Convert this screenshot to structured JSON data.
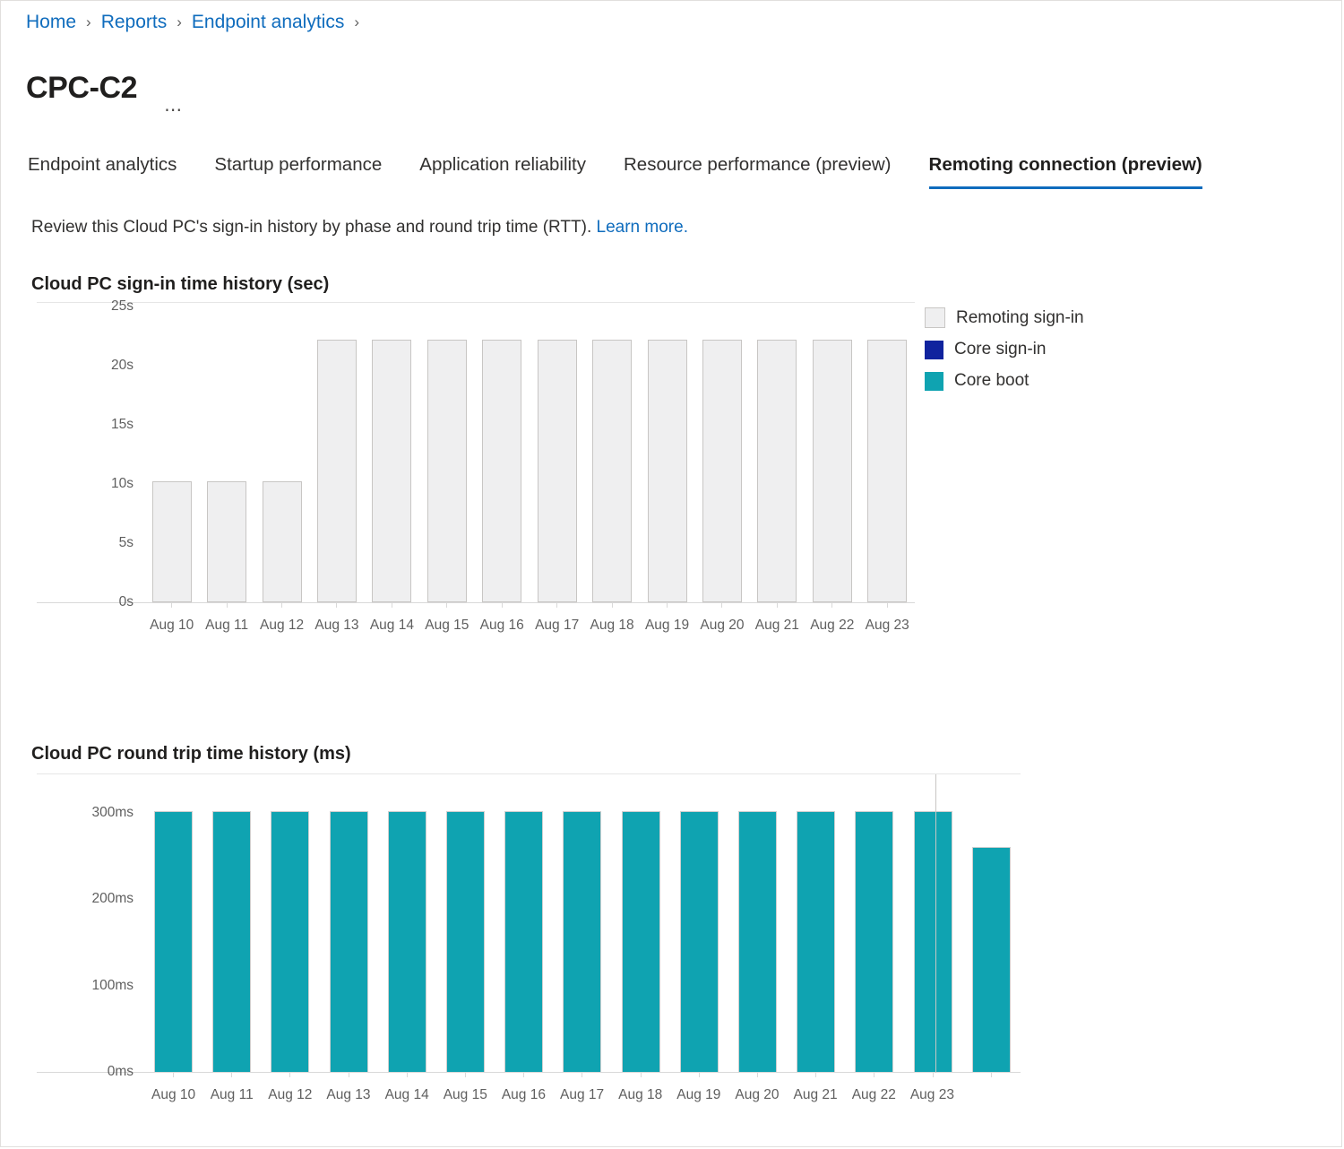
{
  "breadcrumb": {
    "items": [
      {
        "label": "Home"
      },
      {
        "label": "Reports"
      },
      {
        "label": "Endpoint analytics"
      }
    ],
    "separator": "›"
  },
  "header": {
    "title": "CPC-C2",
    "overflow_label": "⋯"
  },
  "tabs": [
    {
      "label": "Endpoint analytics",
      "active": false
    },
    {
      "label": "Startup performance",
      "active": false
    },
    {
      "label": "Application reliability",
      "active": false
    },
    {
      "label": "Resource performance (preview)",
      "active": false
    },
    {
      "label": "Remoting connection (preview)",
      "active": true
    }
  ],
  "description": {
    "text": "Review this Cloud PC's sign-in history by phase and round trip time (RTT).",
    "link_text": "Learn more."
  },
  "legend": {
    "items": [
      {
        "label": "Remoting sign-in",
        "color": "#efeff0"
      },
      {
        "label": "Core sign-in",
        "color": "#10239e"
      },
      {
        "label": "Core boot",
        "color": "#0fa3b1"
      }
    ]
  },
  "colors": {
    "accent": "#0f6cbd",
    "remoting_signin": "#efeff0",
    "core_signin": "#10239e",
    "core_boot": "#0fa3b1",
    "bar_border": "#c8c6c4",
    "axis": "#d9d9d9",
    "text": "#323130",
    "muted_text": "#5f5f5f"
  },
  "chart_data": [
    {
      "type": "bar",
      "name": "signin-time-history",
      "title": "Cloud PC sign-in time history (sec)",
      "xlabel": "",
      "ylabel": "",
      "ylim": [
        0,
        25
      ],
      "ytick_values": [
        0,
        5,
        10,
        15,
        20,
        25
      ],
      "ytick_labels": [
        "0s",
        "5s",
        "10s",
        "15s",
        "20s",
        "25s"
      ],
      "grid": false,
      "legend_position": "right",
      "categories": [
        "Aug 10",
        "Aug 11",
        "Aug 12",
        "Aug 13",
        "Aug 14",
        "Aug 15",
        "Aug 16",
        "Aug 17",
        "Aug 18",
        "Aug 19",
        "Aug 20",
        "Aug 21",
        "Aug 22",
        "Aug 23"
      ],
      "series": [
        {
          "name": "Remoting sign-in",
          "color": "#efeff0",
          "values": [
            10.2,
            10.2,
            10.2,
            22.2,
            22.2,
            22.2,
            22.2,
            22.2,
            22.2,
            22.2,
            22.2,
            22.2,
            22.2,
            22.2
          ]
        }
      ]
    },
    {
      "type": "bar",
      "name": "round-trip-time-history",
      "title": "Cloud PC round trip time history (ms)",
      "xlabel": "",
      "ylabel": "",
      "ylim": [
        0,
        340
      ],
      "ytick_values": [
        0,
        100,
        200,
        300
      ],
      "ytick_labels": [
        "0ms",
        "100ms",
        "200ms",
        "300ms"
      ],
      "grid": false,
      "legend_position": "none",
      "categories": [
        "Aug 10",
        "Aug 11",
        "Aug 12",
        "Aug 13",
        "Aug 14",
        "Aug 15",
        "Aug 16",
        "Aug 17",
        "Aug 18",
        "Aug 19",
        "Aug 20",
        "Aug 21",
        "Aug 22",
        "Aug 23"
      ],
      "series": [
        {
          "name": "Core boot",
          "color": "#0fa3b1",
          "values": [
            302,
            302,
            302,
            302,
            302,
            302,
            302,
            302,
            302,
            302,
            302,
            302,
            302,
            302,
            260
          ]
        }
      ]
    }
  ]
}
